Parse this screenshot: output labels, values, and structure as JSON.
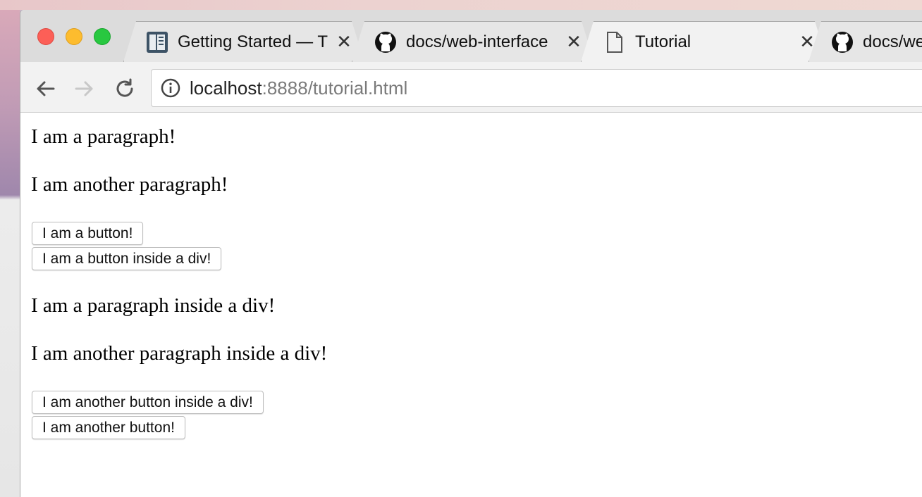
{
  "browser": {
    "tabs": [
      {
        "title": "Getting Started — T",
        "icon": "book-icon",
        "active": false
      },
      {
        "title": "docs/web-interface",
        "icon": "github-icon",
        "active": false
      },
      {
        "title": "Tutorial",
        "icon": "document-icon",
        "active": true
      },
      {
        "title": "docs/we",
        "icon": "github-icon",
        "active": false
      }
    ],
    "url": {
      "host": "localhost",
      "rest": ":8888/tutorial.html"
    }
  },
  "page": {
    "para_1": "I am a paragraph!",
    "para_2": "I am another paragraph!",
    "button_1": "I am a button!",
    "button_2": "I am a button inside a div!",
    "para_3": "I am a paragraph inside a div!",
    "para_4": "I am another paragraph inside a div!",
    "button_3": "I am another button inside a div!",
    "button_4": "I am another button!"
  },
  "colors": {
    "close": "#fc5f57",
    "minimize": "#fdbc2e",
    "maximize": "#28c840"
  }
}
